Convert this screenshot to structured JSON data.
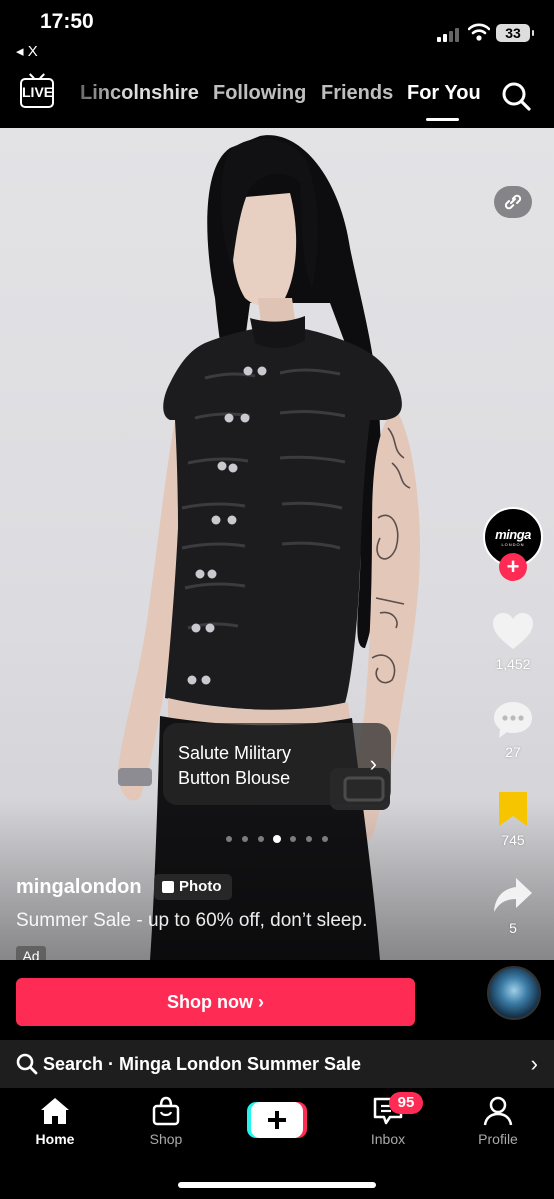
{
  "status_bar": {
    "time": "17:50",
    "back_label": "◂ X",
    "battery": "33"
  },
  "top_nav": {
    "live_label": "LIVE",
    "tabs": [
      {
        "label": "Lincolnshire"
      },
      {
        "label": "Following"
      },
      {
        "label": "Friends"
      },
      {
        "label": "For You"
      }
    ],
    "active_tab": "For You"
  },
  "post": {
    "product_name": "Salute Military Button Blouse",
    "product_chevron": "›",
    "username": "mingalondon",
    "photo_badge": "Photo",
    "caption": "Summer Sale - up to 60% off, don’t sleep.",
    "ad_label": "Ad",
    "carousel": {
      "count": 7,
      "active_index": 3
    }
  },
  "rail": {
    "brand_avatar_text": "minga",
    "brand_avatar_sub": "LONDON",
    "likes": "1,452",
    "comments": "27",
    "saves": "745",
    "shares": "5"
  },
  "cta": {
    "label": "Shop now ›"
  },
  "search_bar": {
    "label": "Search · Minga London Summer Sale",
    "chevron": "›"
  },
  "bottom_nav": {
    "items": [
      {
        "label": "Home"
      },
      {
        "label": "Shop"
      },
      {
        "label": "Inbox"
      },
      {
        "label": "Profile"
      }
    ],
    "inbox_badge": "95"
  },
  "colors": {
    "accent": "#fe2c55",
    "save_yellow": "#f7c400",
    "background": "#000000"
  }
}
